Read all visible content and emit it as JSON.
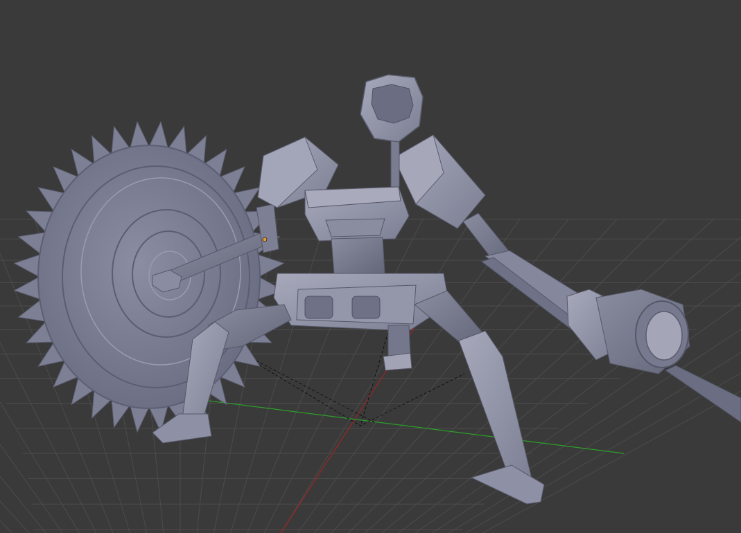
{
  "viewport": {
    "background": "#3a3a3a",
    "grid_color": "#4a4a4a",
    "x_axis_color": "#b02020",
    "y_axis_color": "#27a327",
    "model_color": "#8e90a6",
    "model_shadow": "#6f7186",
    "model_highlight": "#a9abbd",
    "origin_marker_color": "#e69a30"
  }
}
